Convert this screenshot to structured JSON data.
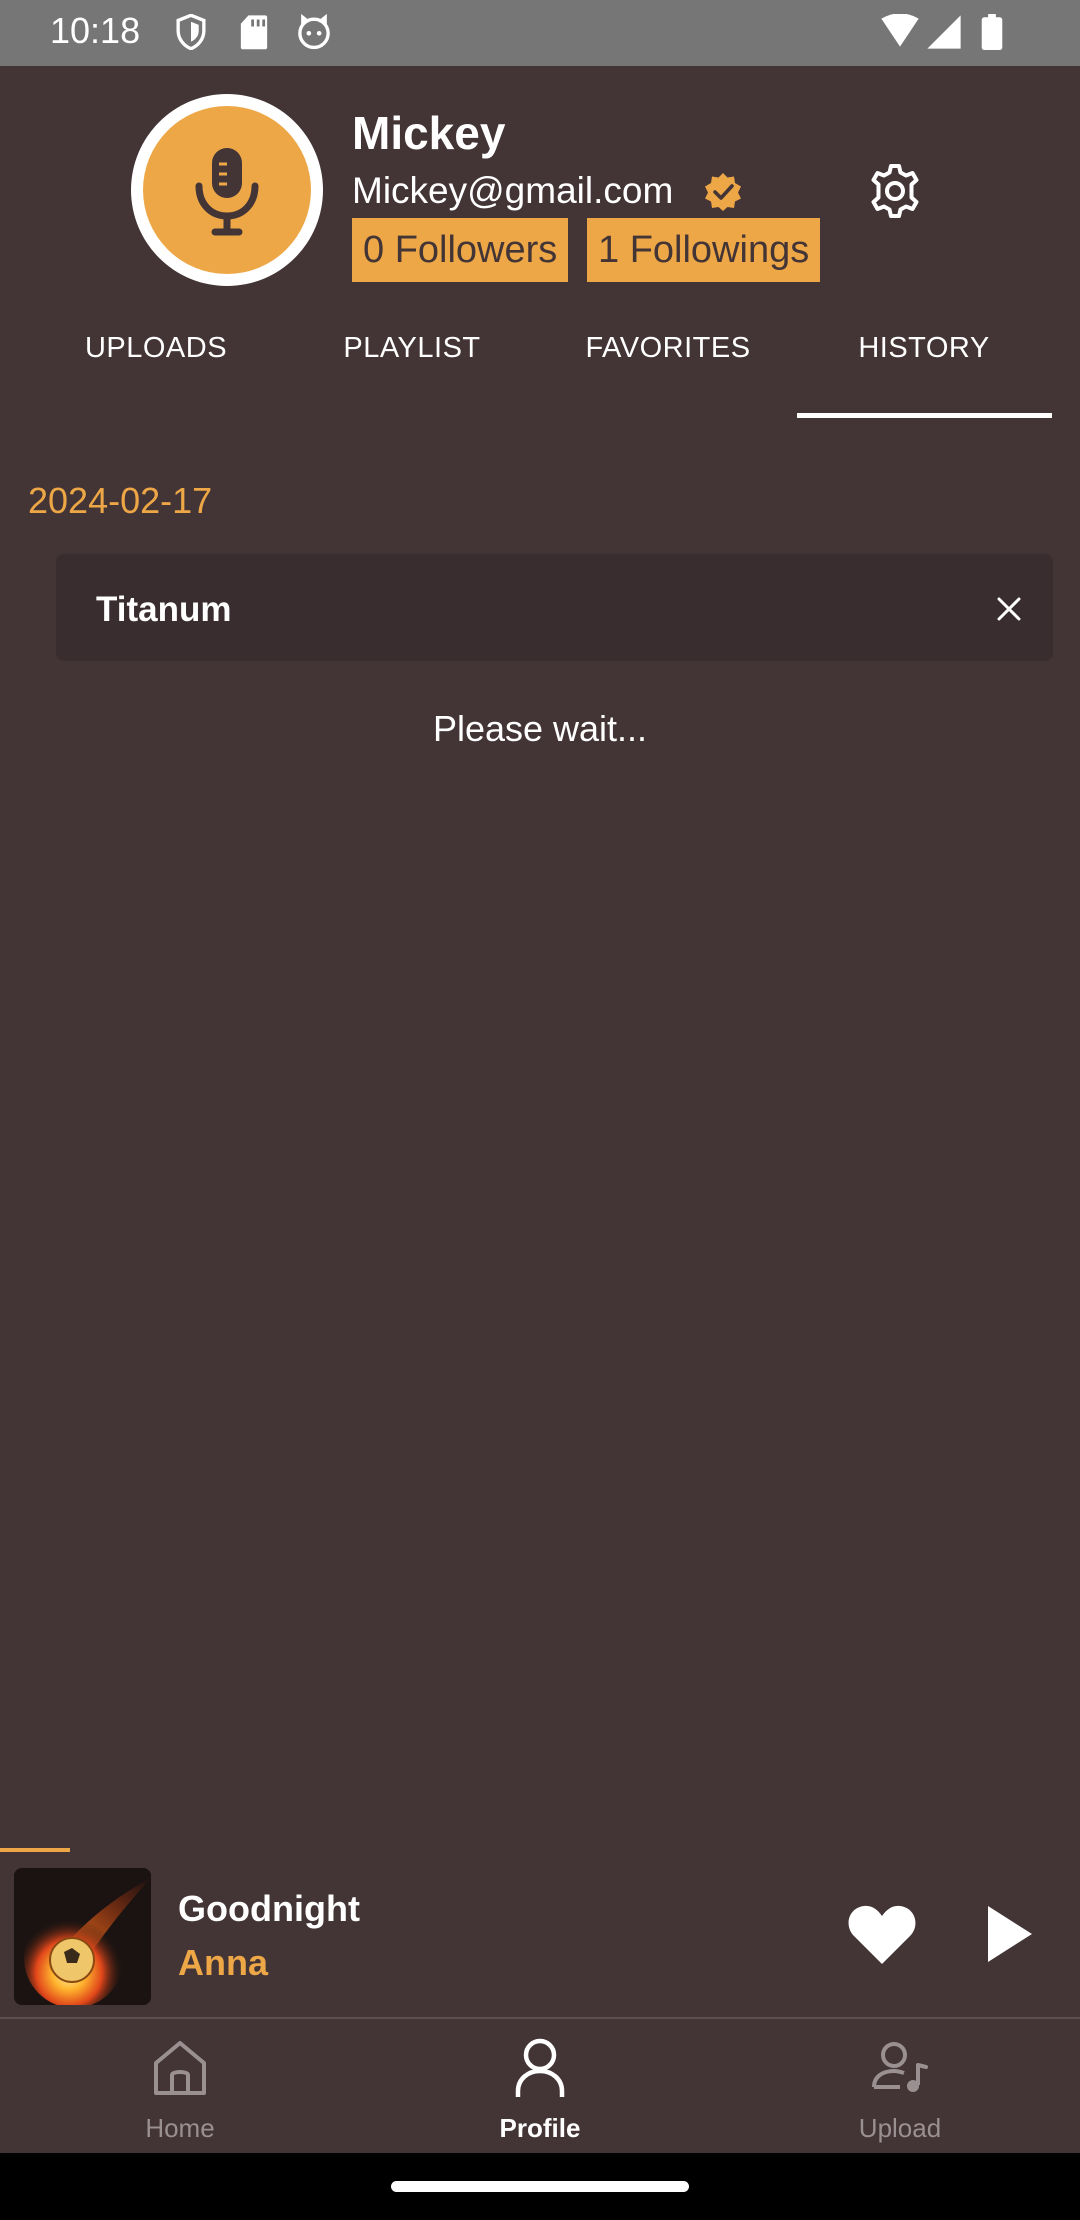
{
  "status_bar": {
    "time": "10:18",
    "left_icons": [
      "shield-icon",
      "sd-card-icon",
      "cat-icon"
    ],
    "right_icons": [
      "wifi-icon",
      "signal-icon",
      "battery-icon"
    ]
  },
  "profile": {
    "name": "Mickey",
    "email": "Mickey@gmail.com",
    "followers_label": "0 Followers",
    "followings_label": "1 Followings",
    "avatar_icon": "microphone-icon",
    "verified_icon": "verified-badge-icon",
    "settings_icon": "gear-icon"
  },
  "tabs": [
    {
      "label": "UPLOADS",
      "active": false
    },
    {
      "label": "PLAYLIST",
      "active": false
    },
    {
      "label": "FAVORITES",
      "active": false
    },
    {
      "label": "HISTORY",
      "active": true
    }
  ],
  "history": {
    "date": "2024-02-17",
    "items": [
      {
        "title": "Titanum"
      }
    ],
    "loading_text": "Please wait..."
  },
  "player": {
    "title": "Goodnight",
    "artist": "Anna",
    "liked": true,
    "progress": 0.06
  },
  "bottom_nav": [
    {
      "label": "Home",
      "icon": "home-icon",
      "active": false
    },
    {
      "label": "Profile",
      "icon": "person-icon",
      "active": true
    },
    {
      "label": "Upload",
      "icon": "upload-music-icon",
      "active": false
    }
  ],
  "colors": {
    "background": "#433436",
    "accent": "#eda746",
    "card": "#3a2d2f",
    "status_bar": "#767676",
    "nav_inactive": "#9a9092"
  }
}
